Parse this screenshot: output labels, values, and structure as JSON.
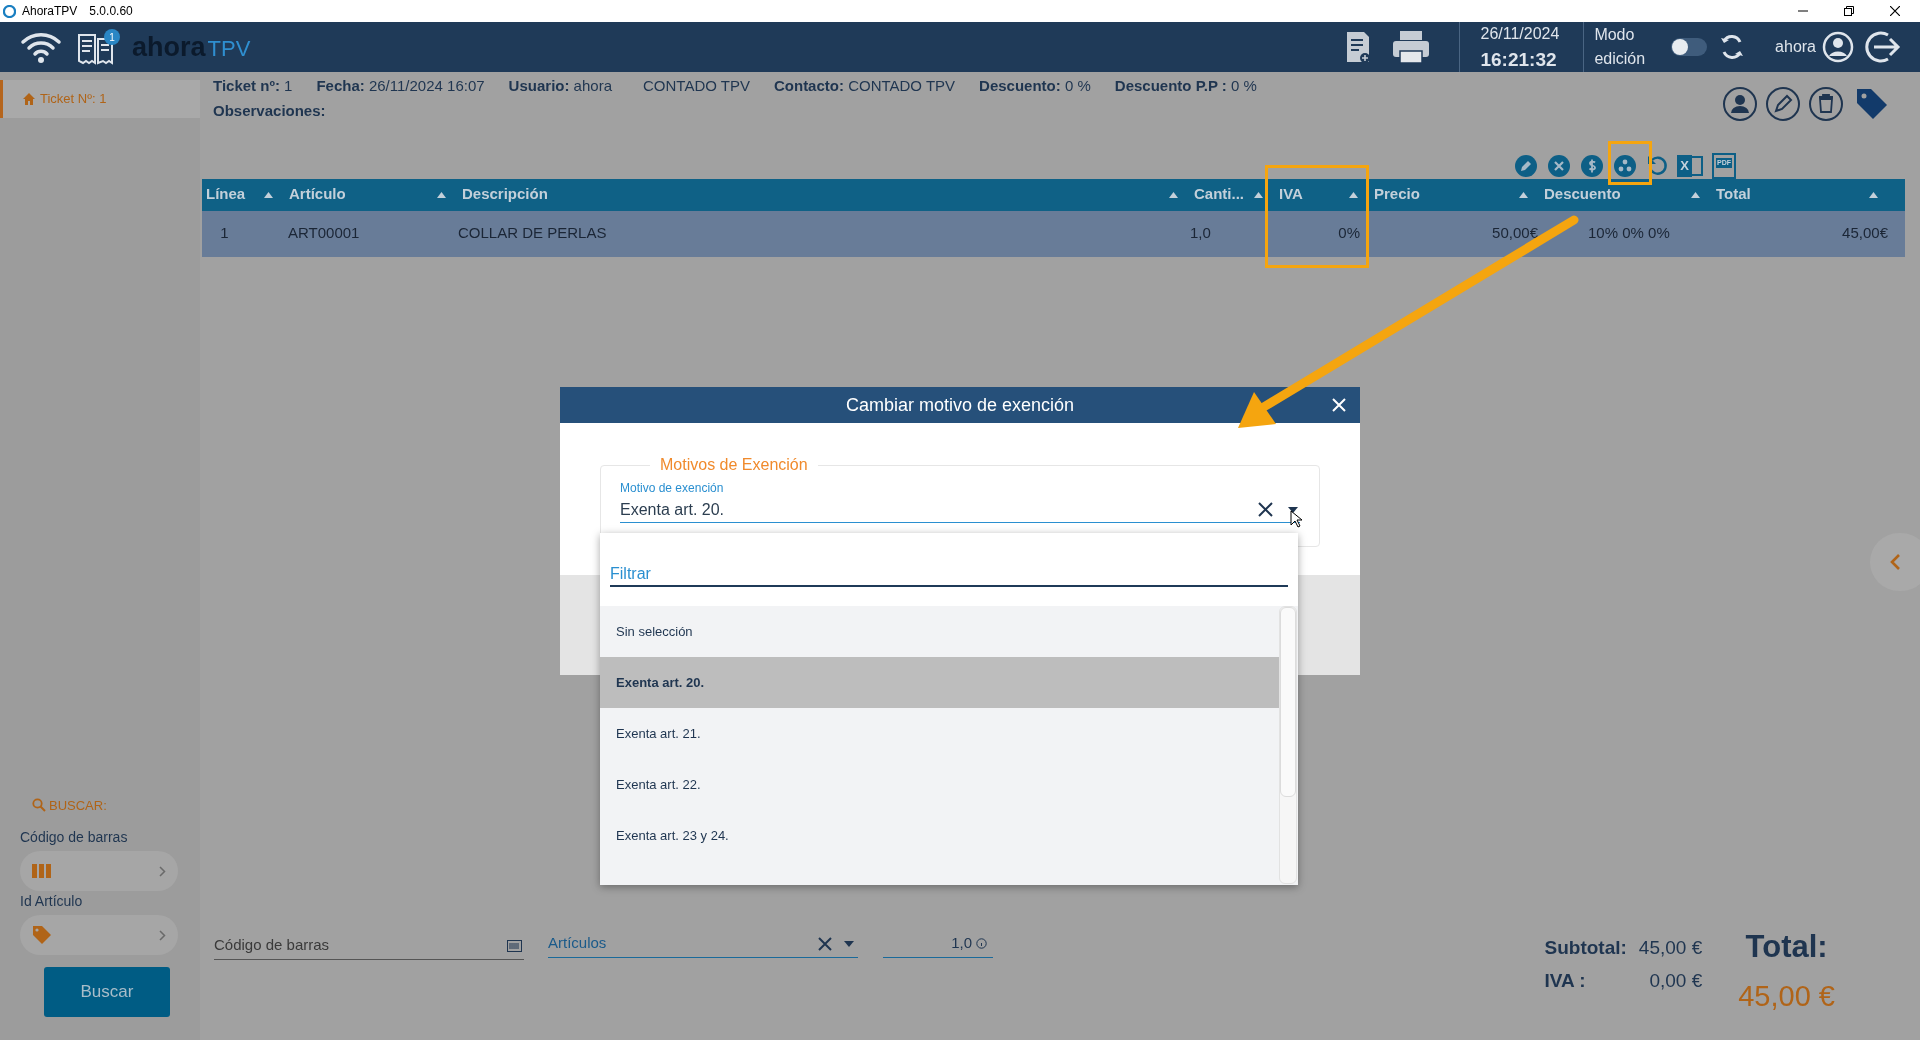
{
  "window": {
    "title": "AhoraTPV",
    "version": "5.0.0.60"
  },
  "topbar": {
    "badge": "1",
    "logo_a": "ahora",
    "logo_b": "TPV",
    "date": "26/11/2024",
    "time": "16:21:32",
    "mode_label": "Modo",
    "mode_label_2": "edición",
    "mode_on": false,
    "user": "ahora"
  },
  "sidebar": {
    "tabs": [
      {
        "label": "Ticket Nº: 1",
        "selected": true
      }
    ],
    "search_title": "BUSCAR:",
    "fields": [
      {
        "label": "Código de barras",
        "kind": "barcode"
      },
      {
        "label": "Id Artículo",
        "kind": "tag"
      }
    ],
    "button": "Buscar"
  },
  "ticket": {
    "fields": [
      {
        "label": "Ticket nº:",
        "value": "1"
      },
      {
        "label": "Fecha:",
        "value": "26/11/2024 16:07"
      },
      {
        "label": "Usuario:",
        "value": "ahora"
      },
      {
        "value": "CONTADO TPV"
      },
      {
        "label": "Contacto:",
        "value": "CONTADO TPV"
      },
      {
        "label": "Descuento:",
        "value": "0 %"
      },
      {
        "label": "Descuento P.P :",
        "value": "0 %"
      }
    ],
    "observaciones": "Observaciones:"
  },
  "toolbar": {
    "excel_glyph": "X",
    "pdf_glyph": "PDF"
  },
  "table": {
    "columns": [
      "Línea",
      "Artículo",
      "Descripción",
      "Canti...",
      "IVA",
      "Precio",
      "Descuento",
      "Total"
    ],
    "rows": [
      {
        "selected": true,
        "cells": [
          "1",
          "ART00001",
          "COLLAR DE PERLAS",
          "1,0",
          "0%",
          "50,00€",
          "10% 0% 0%",
          "45,00€"
        ]
      }
    ]
  },
  "modal": {
    "title": "Cambiar motivo de exención",
    "legend": "Motivos de Exención",
    "field_label": "Motivo de exención",
    "value": "Exenta art. 20.",
    "filter_placeholder": "Filtrar",
    "options": [
      {
        "label": "Sin selección",
        "selected": false
      },
      {
        "label": "Exenta art. 20.",
        "selected": true
      },
      {
        "label": "Exenta art. 21.",
        "selected": false
      },
      {
        "label": "Exenta art. 22.",
        "selected": false
      },
      {
        "label": "Exenta art. 23 y 24.",
        "selected": false
      }
    ]
  },
  "bottom": {
    "barcode_placeholder": "Código de barras",
    "articles_placeholder": "Artículos",
    "quantity": "1,0"
  },
  "totals": {
    "subtotal_label": "Subtotal:",
    "subtotal": "45,00 €",
    "iva_label": "IVA :",
    "iva": "0,00 €",
    "total_label": "Total:",
    "total": "45,00 €"
  }
}
